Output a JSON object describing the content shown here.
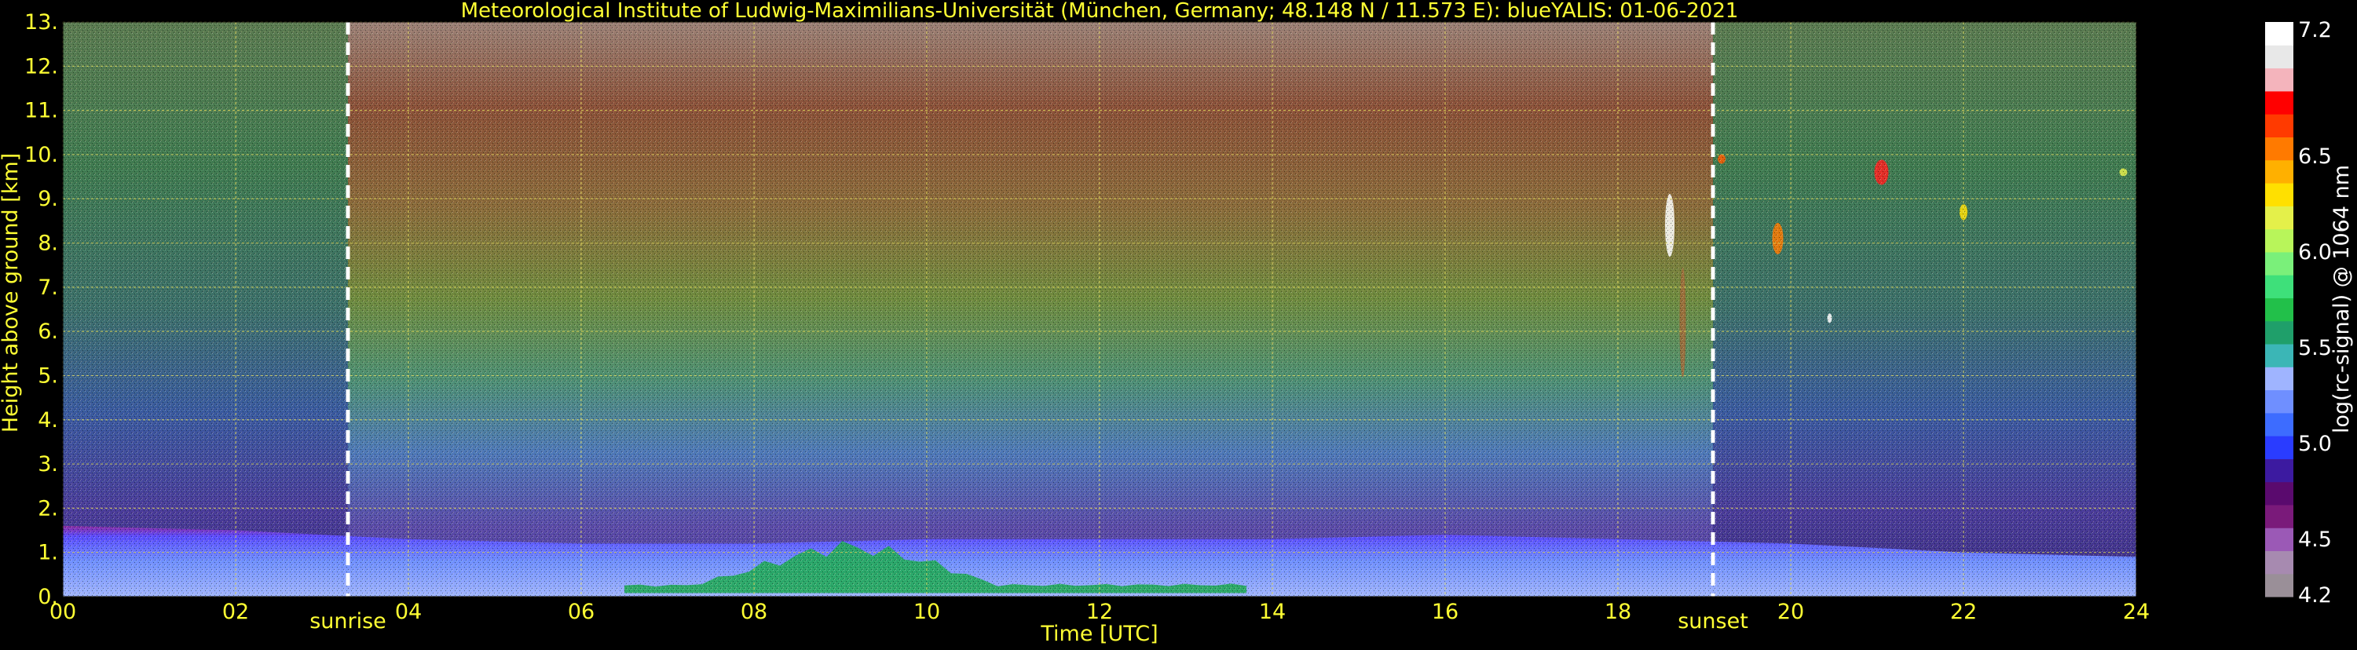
{
  "chart_data": {
    "type": "heatmap",
    "title": "Meteorological Institute of Ludwig-Maximilians-Universität (München, Germany; 48.148 N / 11.573 E):     blueYALIS: 01-06-2021",
    "xlabel": "Time [UTC]",
    "ylabel": "Height above ground [km]",
    "xlim": [
      0,
      24
    ],
    "ylim": [
      0,
      13
    ],
    "x_ticks": [
      "00",
      "02",
      "04",
      "06",
      "08",
      "10",
      "12",
      "14",
      "16",
      "18",
      "20",
      "22",
      "24"
    ],
    "y_ticks": [
      "0.",
      "1.",
      "2.",
      "3.",
      "4.",
      "5.",
      "6.",
      "7.",
      "8.",
      "9.",
      "10.",
      "11.",
      "12.",
      "13."
    ],
    "grid": true,
    "markers": [
      {
        "label": "sunrise",
        "x": 3.3
      },
      {
        "label": "sunset",
        "x": 19.1
      }
    ],
    "colorbar": {
      "label": "log(rc-signal) @ 1064 nm",
      "min": 4.2,
      "max": 7.2,
      "tick_labels": [
        "4.2",
        "4.5",
        "5.0",
        "5.5",
        "6.0",
        "6.5",
        "7.2"
      ],
      "tick_values": [
        4.2,
        4.5,
        5.0,
        5.5,
        6.0,
        6.5,
        7.2
      ],
      "colors": [
        "#9a8f98",
        "#a78ab0",
        "#9b59b6",
        "#7a1a7a",
        "#5a0a6e",
        "#3c1aa0",
        "#2a3cff",
        "#3d6cff",
        "#6f8fff",
        "#9fb4ff",
        "#3bb6b6",
        "#1f9f6a",
        "#22c04a",
        "#3ee07a",
        "#7af07a",
        "#b8f55a",
        "#e4f04a",
        "#ffe000",
        "#ffb000",
        "#ff7a00",
        "#ff3a00",
        "#ff0000",
        "#f4b4bc",
        "#e8e8e8",
        "#ffffff"
      ]
    },
    "features": [
      {
        "name": "boundary layer",
        "x": [
          0,
          24
        ],
        "y_top": [
          1.6,
          1.5,
          1.3,
          1.2,
          1.2,
          1.3,
          1.3,
          1.3,
          1.4,
          1.3,
          1.2,
          1.0,
          0.9
        ]
      },
      {
        "name": "convective aerosol layer",
        "x": [
          6.5,
          13.7
        ],
        "y_top": [
          1.2,
          1.3
        ]
      }
    ]
  }
}
